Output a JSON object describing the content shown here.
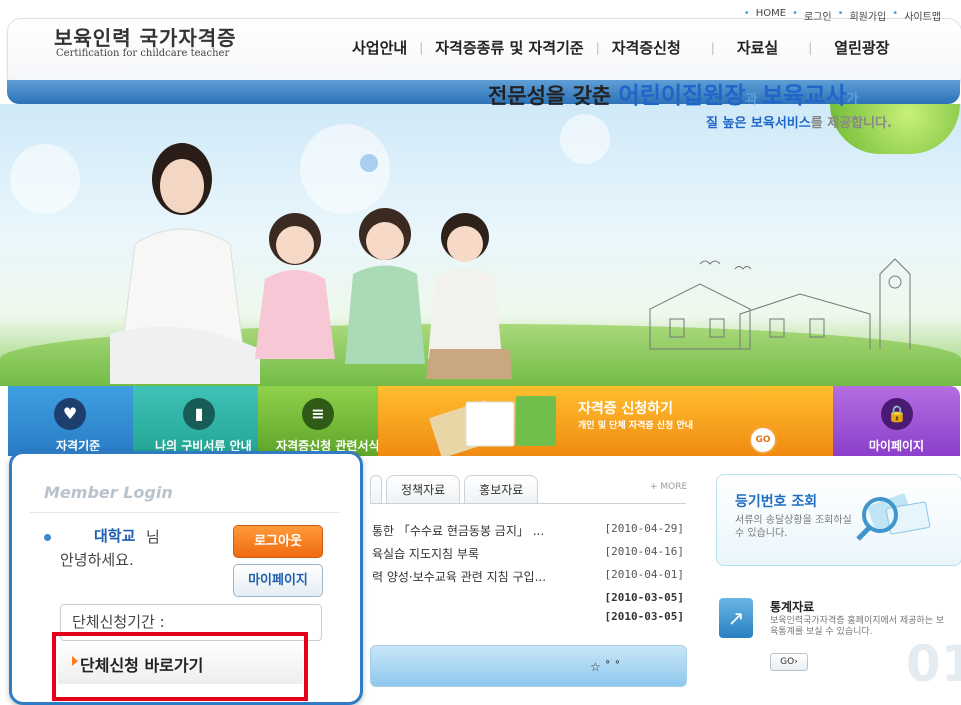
{
  "header": {
    "logo_main": "보육인력 국가자격증",
    "logo_sub": "Certification for childcare teacher",
    "util_links": [
      "HOME",
      "로그인",
      "회원가입",
      "사이트맵"
    ],
    "nav": [
      "사업안내",
      "자격증종류 및 자격기준",
      "자격증신청",
      "자료실",
      "열린광장"
    ]
  },
  "hero": {
    "line1_a": "전문성을 갖춘 ",
    "line1_b": "어린이집원장",
    "line1_c": "과 ",
    "line1_d": "보육교사",
    "line1_e": "가",
    "line2_a": "질 높은 보육서비스",
    "line2_b": "를 제공합니다."
  },
  "quick_menu": {
    "items": [
      "자격기준",
      "나의 구비서류 안내",
      "자격증신청 관련서식",
      "마이페이지"
    ],
    "apply_title": "자격증 신청하기",
    "apply_sub": "개인 및 단체 자격증 신청 안내",
    "go_label": "GO"
  },
  "news": {
    "tabs": [
      "정책자료",
      "홍보자료"
    ],
    "more": "+ MORE",
    "rows": [
      {
        "title": "통한 「수수료 현금동봉 금지」 ...",
        "date": "[2010-04-29]"
      },
      {
        "title": "육실습 지도지침 부록",
        "date": "[2010-04-16]"
      },
      {
        "title": "력 양성·보수교육 관련 지침 구입...",
        "date": "[2010-04-01]"
      },
      {
        "title": "",
        "date": "[2010-03-05]"
      },
      {
        "title": "",
        "date": "[2010-03-05]"
      }
    ]
  },
  "right": {
    "reg_title": "등기번호 조회",
    "reg_desc": "서류의 송달상황을 조회하실 수 있습니다.",
    "stat_title": "통계자료",
    "stat_desc": "보육인력국가자격증 홈페이지에서 제공하는 보육통계를 보실 수 있습니다.",
    "stat_go": "GO›",
    "bignum": "01"
  },
  "login": {
    "title": "Member Login",
    "name": "대학교",
    "name_suffix": "님",
    "greeting": "안녕하세요.",
    "logout_label": "로그아웃",
    "mypage_label": "마이페이지",
    "period_label": "단체신청기간 :",
    "shortcut_label": "단체신청 바로가기"
  },
  "colors": {
    "primary_blue": "#2f7cc4",
    "orange": "#ef6b10",
    "highlight_red": "#e3001b"
  }
}
